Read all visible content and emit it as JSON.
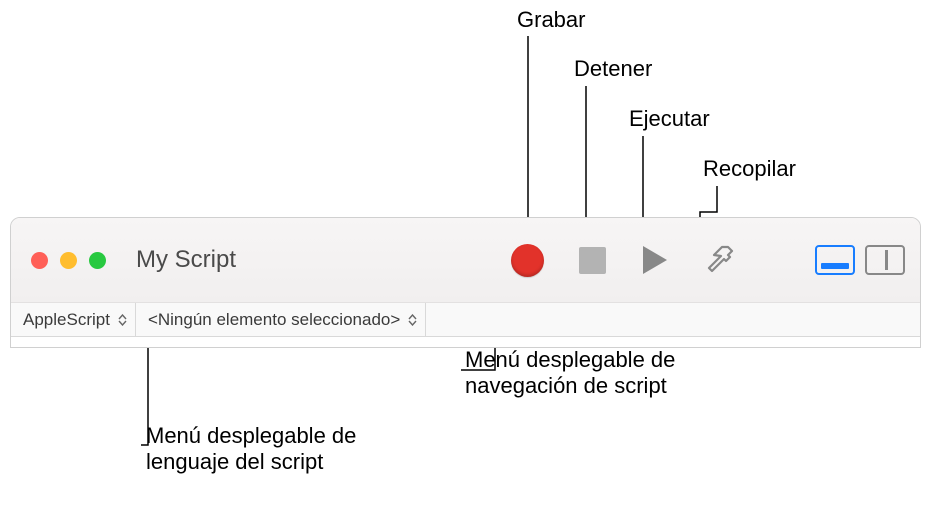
{
  "callouts": {
    "grabar": "Grabar",
    "detener": "Detener",
    "ejecutar": "Ejecutar",
    "recopilar": "Recopilar",
    "nav_menu": "Menú desplegable de navegación de script",
    "lang_menu": "Menú desplegable de lenguaje del script"
  },
  "window": {
    "title": "My Script"
  },
  "subbar": {
    "language_value": "AppleScript",
    "navigation_value": "<Ningún elemento seleccionado>"
  }
}
